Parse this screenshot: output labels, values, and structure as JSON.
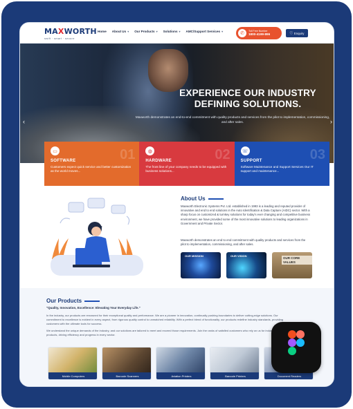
{
  "brand": {
    "logo_text_a": "MA",
    "logo_text_x": "X",
    "logo_text_b": "WORTH",
    "tagline": "swift · smart · secure"
  },
  "nav": {
    "items": [
      {
        "label": "Home",
        "dropdown": false
      },
      {
        "label": "About Us",
        "dropdown": true
      },
      {
        "label": "Our Products",
        "dropdown": true
      },
      {
        "label": "Solutions",
        "dropdown": true
      },
      {
        "label": "AMC/Support Services",
        "dropdown": true
      }
    ],
    "tollfree_label": "Toll Free Number",
    "tollfree_number": "1800-4199-896",
    "enquiry_label": "Enquiry"
  },
  "hero": {
    "heading_line1": "EXPERIENCE OUR INDUSTRY",
    "heading_line2": "DEFINING SOLUTIONS.",
    "description": "Maxworth demonstrates an end-to-end commitment with quality products and services from the pilot to implementation, commissioning, and after sales."
  },
  "cards": [
    {
      "title": "SOFTWARE",
      "number": "01",
      "icon": "monitor-icon",
      "text": "Customers expect quick service and better customization as the world moves..."
    },
    {
      "title": "HARDWARE",
      "number": "02",
      "icon": "globe-icon",
      "text": "The front line of your company needs to be equipped with business solutions..."
    },
    {
      "title": "SUPPORT",
      "number": "03",
      "icon": "support-icon",
      "text": "Software Maintenance and Support Services Our IT support and maintenance..."
    }
  ],
  "about": {
    "title": "About Us",
    "para1": "Maxworth Electronic Systems Pvt. Ltd. established in 1993 is a leading and reputed provider of innovative and end to end solutions in the Auto Identification & Data Capture (AIDC) sector. With a sharp focus on customized & turnkey solutions for today's ever changing and competitive business environment, we have provided some of the most innovative solutions to leading organizations in Government and Private Sector.",
    "para2": "Maxworth demonstrates an end to end commitment with quality products and services from the pilot to implementation, commissioning, and after sales.",
    "thumbs": [
      {
        "label": "OUR MISSION"
      },
      {
        "label": "OUR VISION"
      },
      {
        "label": "OUR CORE VALUES"
      }
    ]
  },
  "products": {
    "title": "Our Products",
    "subtitle": "\"Quality, Innovation, Excellence: Elevating Your Everyday Life.\"",
    "para1": "In the industry, our products are renowned for their exceptional quality and performance. We are a pioneer in innovation, continually pushing boundaries to deliver cutting-edge solutions. Our commitment to excellence is evident in every aspect, from rigorous quality control to unmatched reliability. With a perfect blend of functionality, our products redefine industry standards, providing customers with the ultimate tools for success.",
    "para2": "We understand the unique demands of the industry, and our solutions are tailored to meet and exceed those requirements. Join the ranks of satisfied customers who rely on us for industry-leading products, driving efficiency and progress in every sector.",
    "items": [
      {
        "label": "Mobile Computers"
      },
      {
        "label": "Barcode Scanners"
      },
      {
        "label": "Aviation Printers"
      },
      {
        "label": "Barcode Printers"
      },
      {
        "label": "Document Readers"
      }
    ]
  },
  "colors": {
    "brand_navy": "#1b3a78",
    "accent_orange": "#e36b2c",
    "accent_red": "#d83a3f",
    "accent_blue": "#1e4fb3",
    "tollfree_orange": "#e8522e"
  }
}
